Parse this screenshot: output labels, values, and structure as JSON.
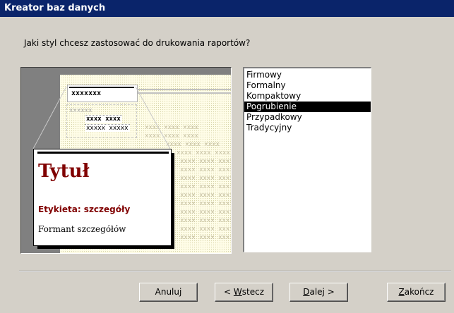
{
  "window": {
    "title": "Kreator baz danych"
  },
  "question": "Jaki styl chcesz zastosować do drukowania raportów?",
  "preview": {
    "mini_header": "xxxxxxx",
    "mini_label": "xxxxxx",
    "mini_row_1": "xxxx xxxx",
    "mini_row_2": "xxxxx xxxxx",
    "ghost_row": "xxxx xxxx xxxx",
    "zoom_title": "Tytuł",
    "zoom_label": "Etykieta: szczegóły",
    "zoom_field": "Formant szczegółów"
  },
  "styles": {
    "items": [
      "Firmowy",
      "Formalny",
      "Kompaktowy",
      "Pogrubienie",
      "Przypadkowy",
      "Tradycyjny"
    ],
    "selected": "Pogrubienie"
  },
  "buttons": {
    "cancel": "Anuluj",
    "back_prefix": "< ",
    "back_key": "W",
    "back_rest": "stecz",
    "next_key": "D",
    "next_rest": "alej >",
    "finish_key": "Z",
    "finish_rest": "akończ"
  }
}
